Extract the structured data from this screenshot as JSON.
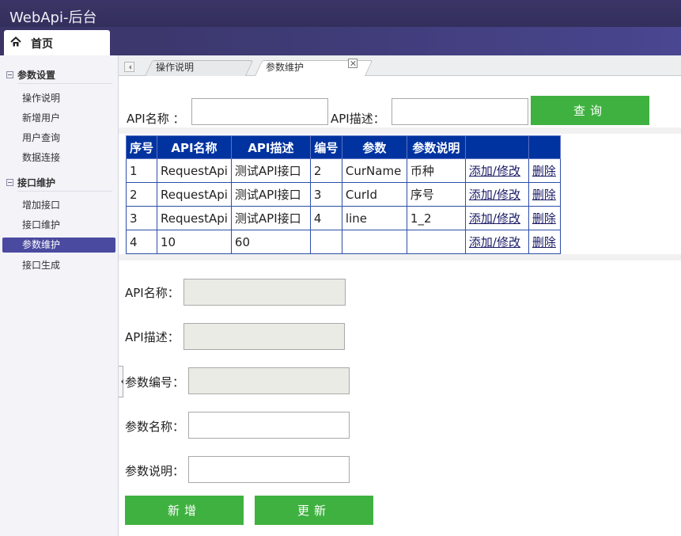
{
  "app": {
    "title": "WebApi-后台"
  },
  "home_tab": {
    "label": "首页",
    "icon": "home-icon"
  },
  "sidebar": {
    "groups": [
      {
        "title": "参数设置",
        "items": [
          "操作说明",
          "新增用户",
          "用户查询",
          "数据连接"
        ]
      },
      {
        "title": "接口维护",
        "items": [
          "增加接口",
          "接口维护",
          "参数维护",
          "接口生成"
        ]
      }
    ],
    "active_item": "参数维护"
  },
  "tabs": [
    {
      "label": "操作说明",
      "active": false
    },
    {
      "label": "参数维护",
      "active": true,
      "closable": true
    }
  ],
  "search": {
    "api_name_label": "API名称 ：",
    "api_name_value": "",
    "api_desc_label": "API描述：",
    "api_desc_value": "",
    "query_button": "查询"
  },
  "table": {
    "columns": [
      "序号",
      "API名称",
      "API描述",
      "编号",
      "参数",
      "参数说明",
      "",
      ""
    ],
    "rows": [
      [
        "1",
        "RequestApi",
        "测试API接口",
        "2",
        "CurName",
        "币种",
        "添加/修改",
        "删除"
      ],
      [
        "2",
        "RequestApi",
        "测试API接口",
        "3",
        "CurId",
        "序号",
        "添加/修改",
        "删除"
      ],
      [
        "3",
        "RequestApi",
        "测试API接口",
        "4",
        "line",
        "1_2",
        "添加/修改",
        "删除"
      ],
      [
        "4",
        "10",
        "60",
        "",
        "",
        "",
        "添加/修改",
        "删除"
      ]
    ]
  },
  "form": {
    "api_name_label": "API名称：",
    "api_desc_label": "API描述：",
    "param_no_label": "参数编号：",
    "param_name_label": "参数名称：",
    "param_desc_label": "参数说明：",
    "add_button": "新增",
    "update_button": "更新"
  },
  "colors": {
    "header": "#3e3a74",
    "table_header": "#0033a0",
    "button": "#3fb140",
    "active_nav": "#4a4aa0"
  }
}
